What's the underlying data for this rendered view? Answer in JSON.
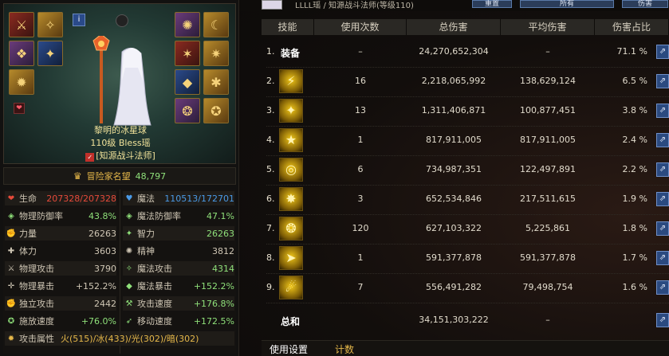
{
  "character": {
    "name": "黎明的冰星球",
    "level_line": "110级 Bless瑶",
    "guild": "[知源战斗法师]",
    "fame_label": "冒险家名望",
    "fame_value": "48,797"
  },
  "stats": [
    {
      "label": "生命",
      "value": "207328/207328",
      "color": "#e64a3a",
      "icon": "heart-icon"
    },
    {
      "label": "魔法",
      "value": "110513/172701",
      "color": "#4a9ae6",
      "icon": "mana-icon"
    },
    {
      "label": "物理防御率",
      "value": "43.8%",
      "color": "#8fe07a",
      "icon": "shield-icon"
    },
    {
      "label": "魔法防御率",
      "value": "47.1%",
      "color": "#8fe07a",
      "icon": "magic-shield-icon"
    },
    {
      "label": "力量",
      "value": "26263",
      "color": "#cfc6b4",
      "icon": "strength-icon"
    },
    {
      "label": "智力",
      "value": "26263",
      "color": "#8fe07a",
      "icon": "intelligence-icon"
    },
    {
      "label": "体力",
      "value": "3603",
      "color": "#cfc6b4",
      "icon": "vitality-icon"
    },
    {
      "label": "精神",
      "value": "3812",
      "color": "#cfc6b4",
      "icon": "spirit-icon"
    },
    {
      "label": "物理攻击",
      "value": "3790",
      "color": "#cfc6b4",
      "icon": "sword-icon"
    },
    {
      "label": "魔法攻击",
      "value": "4314",
      "color": "#8fe07a",
      "icon": "staff-icon"
    },
    {
      "label": "物理暴击",
      "value": "+152.2%",
      "color": "#cfc6b4",
      "icon": "crit-icon"
    },
    {
      "label": "魔法暴击",
      "value": "+152.2%",
      "color": "#8fe07a",
      "icon": "magic-crit-icon"
    },
    {
      "label": "独立攻击",
      "value": "2442",
      "color": "#cfc6b4",
      "icon": "fist-icon"
    },
    {
      "label": "攻击速度",
      "value": "+176.8%",
      "color": "#8fe07a",
      "icon": "attack-speed-icon"
    },
    {
      "label": "施放速度",
      "value": "+76.0%",
      "color": "#8fe07a",
      "icon": "cast-speed-icon"
    },
    {
      "label": "移动速度",
      "value": "+172.5%",
      "color": "#8fe07a",
      "icon": "boot-icon"
    },
    {
      "label": "攻击属性",
      "value": "火(515)/冰(433)/光(302)/暗(302)",
      "color": "#e6b84a",
      "icon": "element-icon"
    }
  ],
  "topbar": {
    "title": "LLLL瑶 / 知源战斗法师(等级110)",
    "btn1": "重置",
    "btn2": "所有",
    "btn3": "伤害"
  },
  "table": {
    "headers": [
      "技能",
      "使用次数",
      "总伤害",
      "平均伤害",
      "伤害占比"
    ],
    "rows": [
      {
        "rank": "1.",
        "skill": "装备",
        "count": "–",
        "total": "24,270,652,304",
        "avg": "–",
        "pct": "71.1 %",
        "glyph": ""
      },
      {
        "rank": "2.",
        "skill": "",
        "count": "16",
        "total": "2,218,065,992",
        "avg": "138,629,124",
        "pct": "6.5 %",
        "glyph": "⚡"
      },
      {
        "rank": "3.",
        "skill": "",
        "count": "13",
        "total": "1,311,406,871",
        "avg": "100,877,451",
        "pct": "3.8 %",
        "glyph": "✦"
      },
      {
        "rank": "4.",
        "skill": "",
        "count": "1",
        "total": "817,911,005",
        "avg": "817,911,005",
        "pct": "2.4 %",
        "glyph": "★"
      },
      {
        "rank": "5.",
        "skill": "",
        "count": "6",
        "total": "734,987,351",
        "avg": "122,497,891",
        "pct": "2.2 %",
        "glyph": "◎"
      },
      {
        "rank": "6.",
        "skill": "",
        "count": "3",
        "total": "652,534,846",
        "avg": "217,511,615",
        "pct": "1.9 %",
        "glyph": "✸"
      },
      {
        "rank": "7.",
        "skill": "",
        "count": "120",
        "total": "627,103,322",
        "avg": "5,225,861",
        "pct": "1.8 %",
        "glyph": "❂"
      },
      {
        "rank": "8.",
        "skill": "",
        "count": "1",
        "total": "591,377,878",
        "avg": "591,377,878",
        "pct": "1.7 %",
        "glyph": "➤"
      },
      {
        "rank": "9.",
        "skill": "",
        "count": "7",
        "total": "556,491,282",
        "avg": "79,498,754",
        "pct": "1.6 %",
        "glyph": "☄"
      }
    ],
    "total_label": "总和",
    "total_value": "34,151,303,222",
    "total_avg": "–"
  },
  "tabs": [
    "使用设置",
    "计数"
  ]
}
